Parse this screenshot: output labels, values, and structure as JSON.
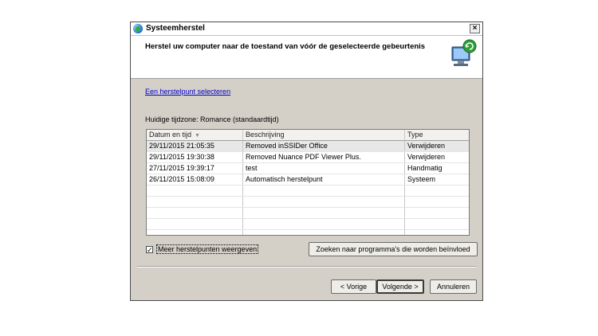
{
  "window": {
    "title": "Systeemherstel"
  },
  "header": {
    "title": "Herstel uw computer naar de toestand van vóór de geselecteerde gebeurtenis"
  },
  "link": {
    "text": "Een herstelpunt selecteren"
  },
  "timezone": {
    "text": "Huidige tijdzone: Romance (standaardtijd)"
  },
  "table": {
    "columns": [
      "Datum en tijd",
      "Beschrijving",
      "Type"
    ],
    "rows": [
      {
        "date": "29/11/2015 21:05:35",
        "desc": "Removed inSSIDer Office",
        "type": "Verwijderen"
      },
      {
        "date": "29/11/2015 19:30:38",
        "desc": "Removed Nuance PDF Viewer Plus.",
        "type": "Verwijderen"
      },
      {
        "date": "27/11/2015 19:39:17",
        "desc": "test",
        "type": "Handmatig"
      },
      {
        "date": "26/11/2015 15:08:09",
        "desc": "Automatisch herstelpunt",
        "type": "Systeem"
      }
    ]
  },
  "checkbox": {
    "label": "Meer herstelpunten weergeven",
    "checked": true
  },
  "buttons": {
    "search": "Zoeken naar programma's die worden beïnvloed",
    "back": "< Vorige",
    "next": "Volgende >",
    "cancel": "Annuleren"
  },
  "icons": {
    "title": "system-restore-icon",
    "header": "computer-restore-icon"
  }
}
